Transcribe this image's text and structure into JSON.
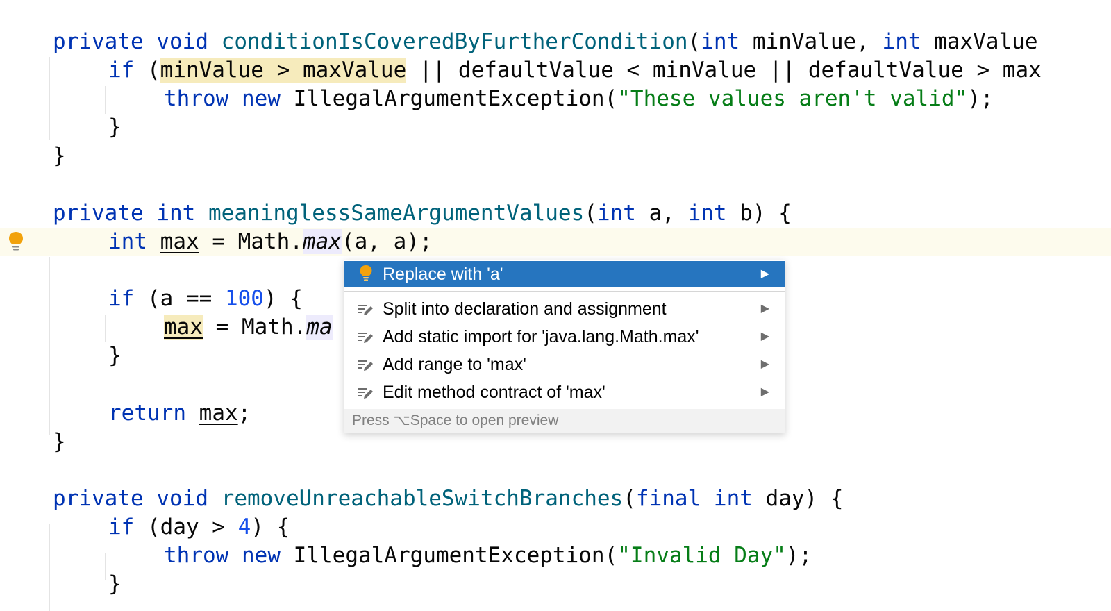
{
  "popup": {
    "items": [
      {
        "label": "Replace with 'a'",
        "icon": "lightbulb-icon",
        "selected": true
      },
      {
        "label": "Split into declaration and assignment",
        "icon": "intention-icon"
      },
      {
        "label": "Add static import for 'java.lang.Math.max'",
        "icon": "intention-icon"
      },
      {
        "label": "Add range to 'max'",
        "icon": "intention-icon"
      },
      {
        "label": "Edit method contract of 'max'",
        "icon": "intention-icon"
      }
    ],
    "submenu_glyph": "▶",
    "footer": "Press ⌥Space to open preview"
  },
  "code": {
    "l1": {
      "kw1": "private",
      "kw2": "void",
      "fn": "conditionIsCoveredByFurtherCondition",
      "p1": "(",
      "kw3": "int",
      "t1": " minValue, ",
      "kw4": "int",
      "t2": " maxValue"
    },
    "l2": {
      "kw1": "if",
      "t1": " (",
      "hl": "minValue > maxValue",
      "t2": " || defaultValue < minValue || defaultValue > max"
    },
    "l3": {
      "kw1": "throw",
      "kw2": "new",
      "t1": " IllegalArgumentException(",
      "str": "\"These values aren't valid\"",
      "t2": ");"
    },
    "l4": {
      "t1": "}"
    },
    "l5": {
      "t1": "}"
    },
    "l6": {
      "kw1": "private",
      "kw2": "int",
      "fn": "meaninglessSameArgumentValues",
      "t1": "(",
      "kw3": "int",
      "t2": " a, ",
      "kw4": "int",
      "t3": " b) {"
    },
    "l7": {
      "kw1": "int",
      "var": "max",
      "t1": " = Math.",
      "call": "max",
      "t2": "(a, a);"
    },
    "l8": {
      "kw1": "if",
      "t1": " (a == ",
      "num": "100",
      "t2": ") {"
    },
    "l9": {
      "var": "max",
      "t1": " = Math.",
      "call": "ma"
    },
    "l10": {
      "t1": "}"
    },
    "l11": {
      "kw1": "return",
      "var": "max",
      "t1": ";"
    },
    "l12": {
      "t1": "}"
    },
    "l13": {
      "kw1": "private",
      "kw2": "void",
      "fn": "removeUnreachableSwitchBranches",
      "t1": "(",
      "kw3": "final",
      "kw4": "int",
      "t2": " day) {"
    },
    "l14": {
      "kw1": "if",
      "t1": " (day > ",
      "num": "4",
      "t2": ") {"
    },
    "l15": {
      "kw1": "throw",
      "kw2": "new",
      "t1": " IllegalArgumentException(",
      "str": "\"Invalid Day\"",
      "t2": ");"
    },
    "l16": {
      "t1": "}"
    }
  },
  "colors": {
    "keyword": "#0033b3",
    "method": "#00627a",
    "string": "#067d17",
    "number": "#1750eb",
    "selection": "#2675bf",
    "bulb": "#f2a20c"
  }
}
